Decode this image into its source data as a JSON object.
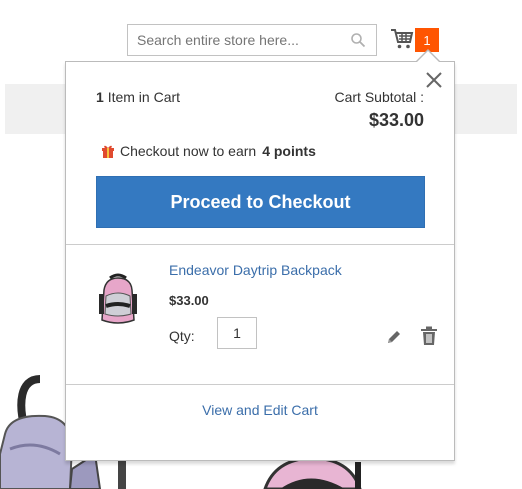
{
  "header": {
    "search_placeholder": "Search entire store here...",
    "cart_count": "1"
  },
  "minicart": {
    "items_count": "1",
    "items_label": "Item in Cart",
    "subtotal_label": "Cart Subtotal :",
    "subtotal_amount": "$33.00",
    "points_text": "Checkout now to earn",
    "points_value": "4 points",
    "checkout_label": "Proceed to Checkout",
    "product": {
      "name": "Endeavor Daytrip Backpack",
      "price": "$33.00",
      "qty_label": "Qty:",
      "qty_value": "1"
    },
    "view_cart_label": "View and Edit Cart"
  },
  "colors": {
    "accent": "#3479c1",
    "badge": "#ff5501",
    "link": "#3b6eaa"
  },
  "icons": [
    "search-icon",
    "cart-icon",
    "close-icon",
    "gift-icon",
    "edit-icon",
    "trash-icon"
  ]
}
